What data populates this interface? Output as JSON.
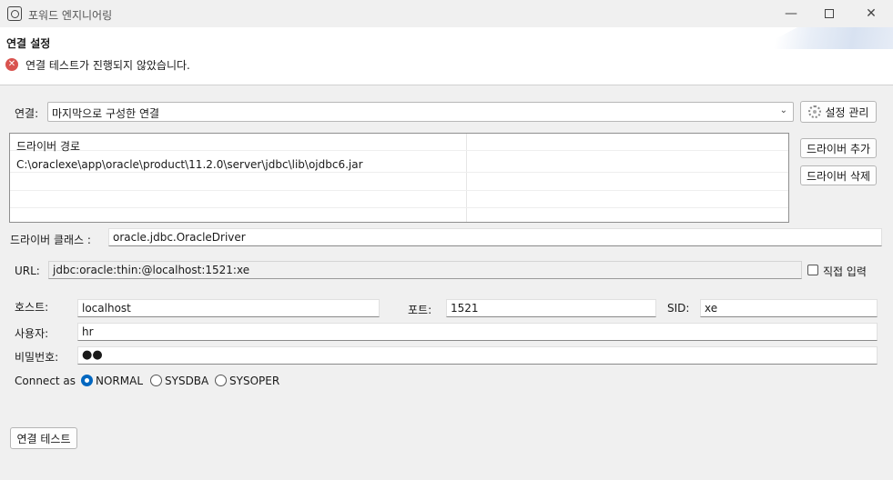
{
  "window": {
    "title": "포워드 엔지니어링",
    "minimize": "—",
    "close": "✕"
  },
  "header": {
    "title": "연결 설정",
    "status_message": "연결 테스트가 진행되지 않았습니다.",
    "error_icon": "✕"
  },
  "connection": {
    "label": "연결:",
    "selected": "마지막으로 구성한 연결",
    "settings_button": "설정 관리"
  },
  "drivers": {
    "column_header": "드라이버 경로",
    "rows": [
      "C:\\oraclexe\\app\\oracle\\product\\11.2.0\\server\\jdbc\\lib\\ojdbc6.jar"
    ],
    "add_button": "드라이버 추가",
    "remove_button": "드라이버 삭제"
  },
  "driver_class": {
    "label": "드라이버 클래스 :",
    "value": "oracle.jdbc.OracleDriver"
  },
  "url": {
    "label": "URL:",
    "value": "jdbc:oracle:thin:@localhost:1521:xe",
    "direct_input_label": "직접 입력",
    "direct_input_checked": false
  },
  "host": {
    "label": "호스트:",
    "value": "localhost"
  },
  "port": {
    "label": "포트:",
    "value": "1521"
  },
  "sid": {
    "label": "SID:",
    "value": "xe"
  },
  "user": {
    "label": "사용자:",
    "value": "hr"
  },
  "password": {
    "label": "비밀번호:",
    "value": "●●"
  },
  "connect_as": {
    "label": "Connect as",
    "options": [
      "NORMAL",
      "SYSDBA",
      "SYSOPER"
    ],
    "selected": "NORMAL"
  },
  "test_button": "연결 테스트"
}
